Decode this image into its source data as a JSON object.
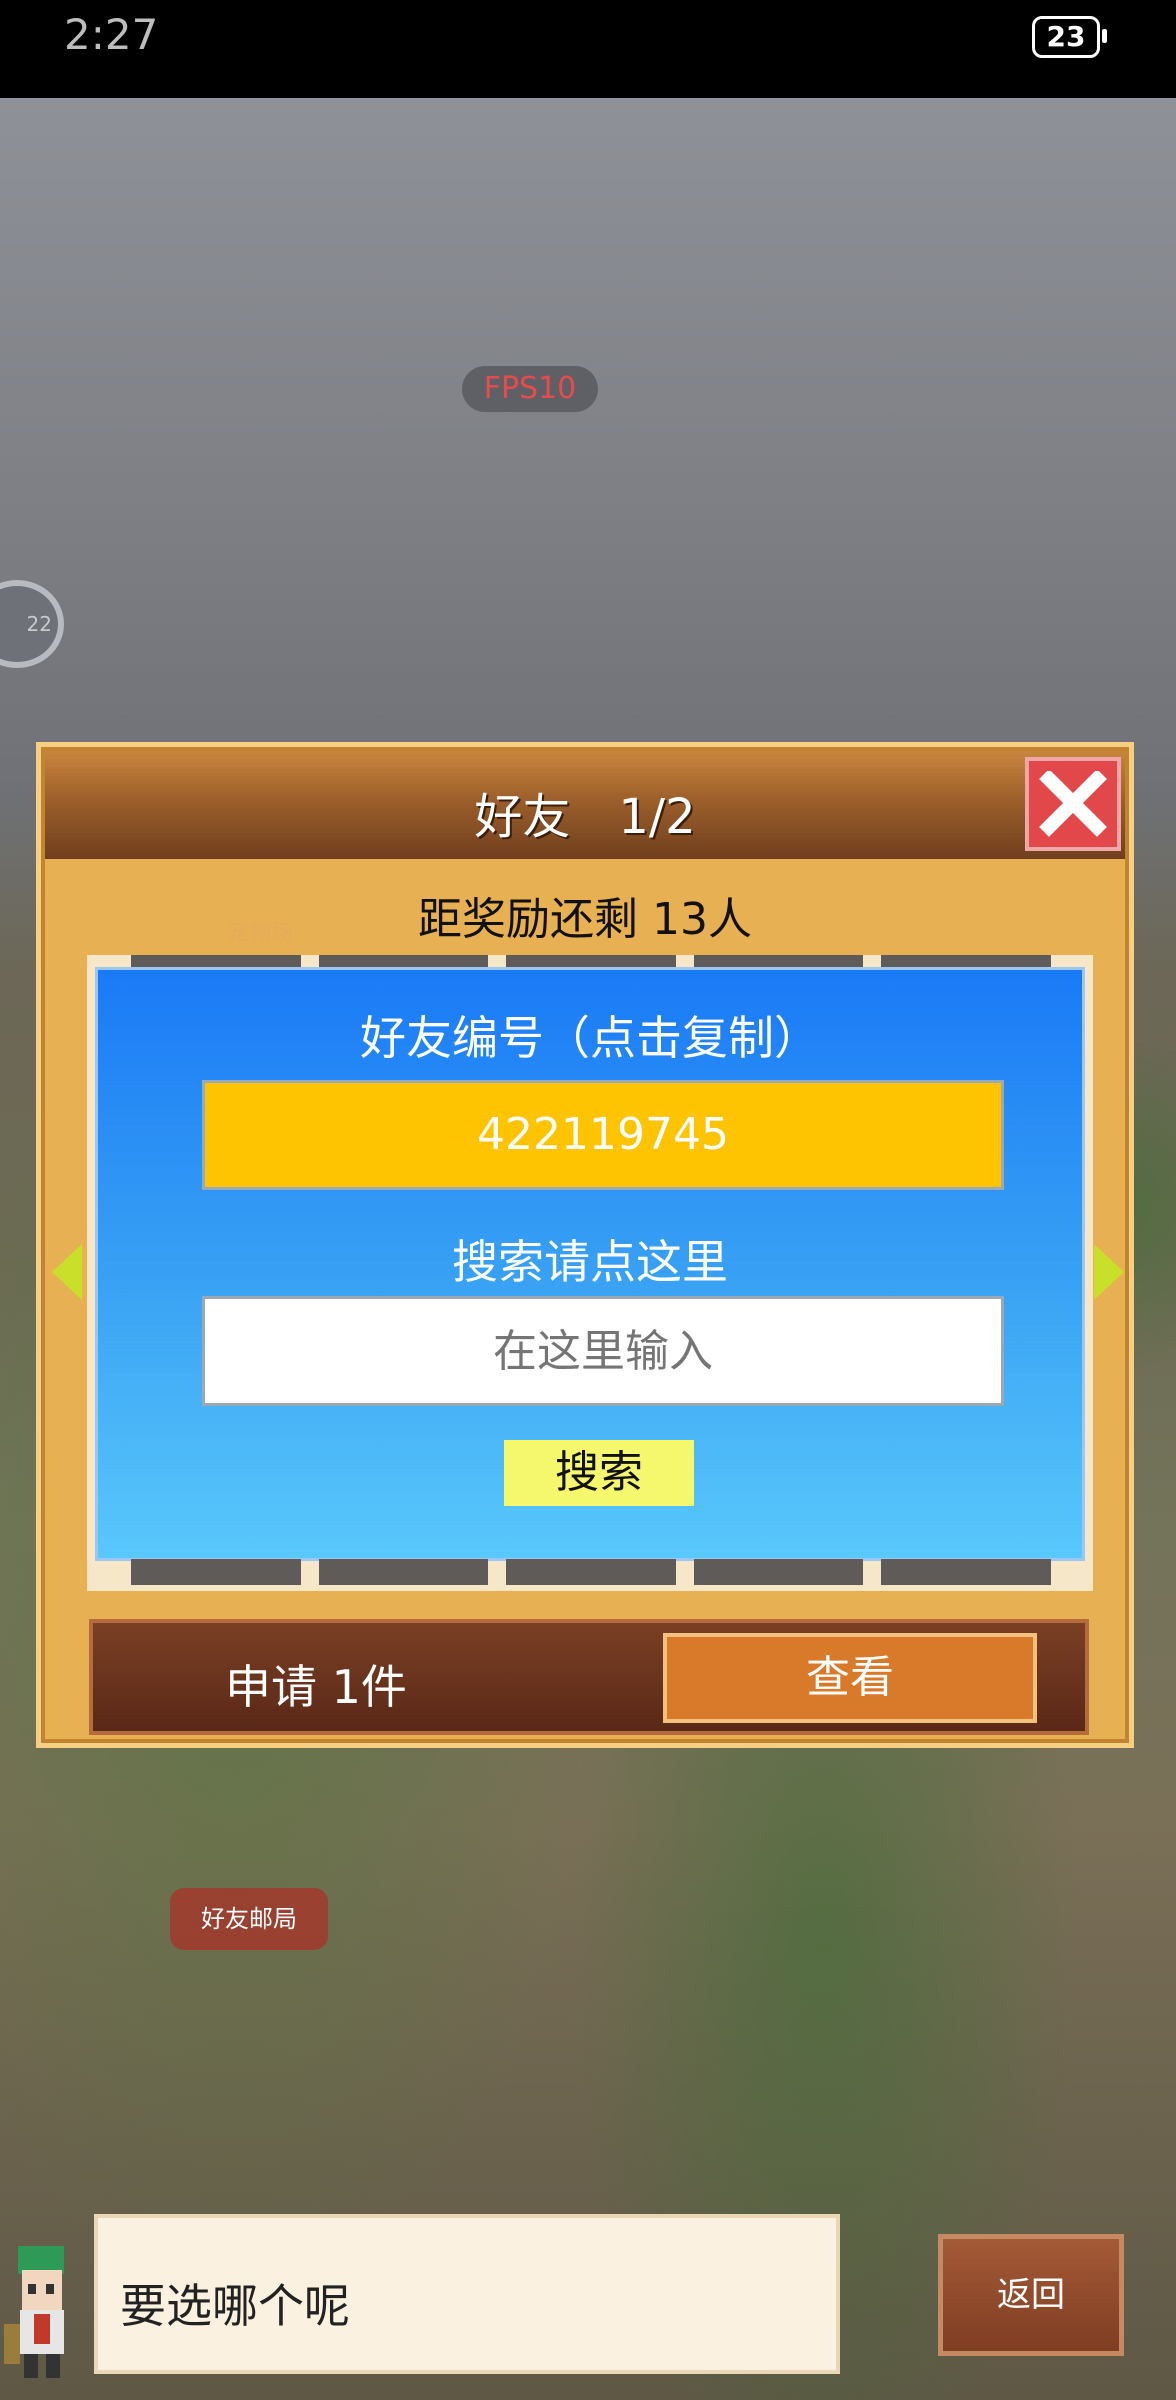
{
  "status_bar": {
    "time": "2:27",
    "battery": "23"
  },
  "overlay": {
    "fps": "FPS10",
    "ring_text": "22"
  },
  "dialog": {
    "title": "好友　1/2",
    "subtitle": "距奖励还剩 13人",
    "faded_label": "宠物场",
    "friend_id_label": "好友编号（点击复制）",
    "friend_id": "422119745",
    "search_label": "搜索请点这里",
    "search_placeholder": "在这里输入",
    "search_button": "搜索",
    "requests": "申请 1件",
    "view_button": "查看"
  },
  "scene": {
    "mail_label": "好友邮局"
  },
  "bottom": {
    "message": "要选哪个呢",
    "back_button": "返回"
  }
}
